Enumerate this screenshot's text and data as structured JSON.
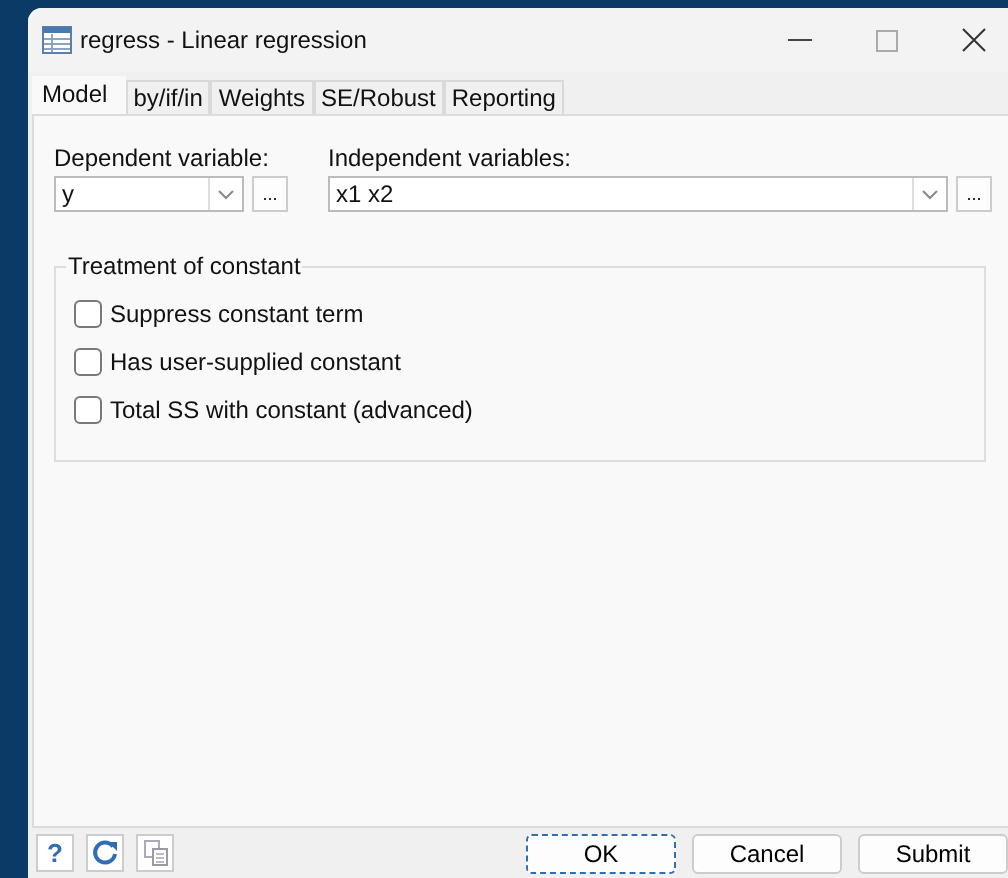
{
  "window": {
    "title": "regress - Linear regression"
  },
  "tabs": [
    {
      "label": "Model",
      "selected": true
    },
    {
      "label": "by/if/in",
      "selected": false
    },
    {
      "label": "Weights",
      "selected": false
    },
    {
      "label": "SE/Robust",
      "selected": false
    },
    {
      "label": "Reporting",
      "selected": false
    }
  ],
  "dependent": {
    "label": "Dependent variable:",
    "value": "y",
    "browse": "..."
  },
  "independent": {
    "label": "Independent variables:",
    "value": "x1 x2",
    "browse": "..."
  },
  "constant_group": {
    "title": "Treatment of constant",
    "options": [
      {
        "label": "Suppress constant term",
        "checked": false
      },
      {
        "label": "Has user-supplied constant",
        "checked": false
      },
      {
        "label": "Total SS with constant (advanced)",
        "checked": false
      }
    ]
  },
  "footer": {
    "help": "?",
    "buttons": [
      {
        "label": "OK",
        "selected": true
      },
      {
        "label": "Cancel",
        "selected": false
      },
      {
        "label": "Submit",
        "selected": false
      }
    ]
  }
}
